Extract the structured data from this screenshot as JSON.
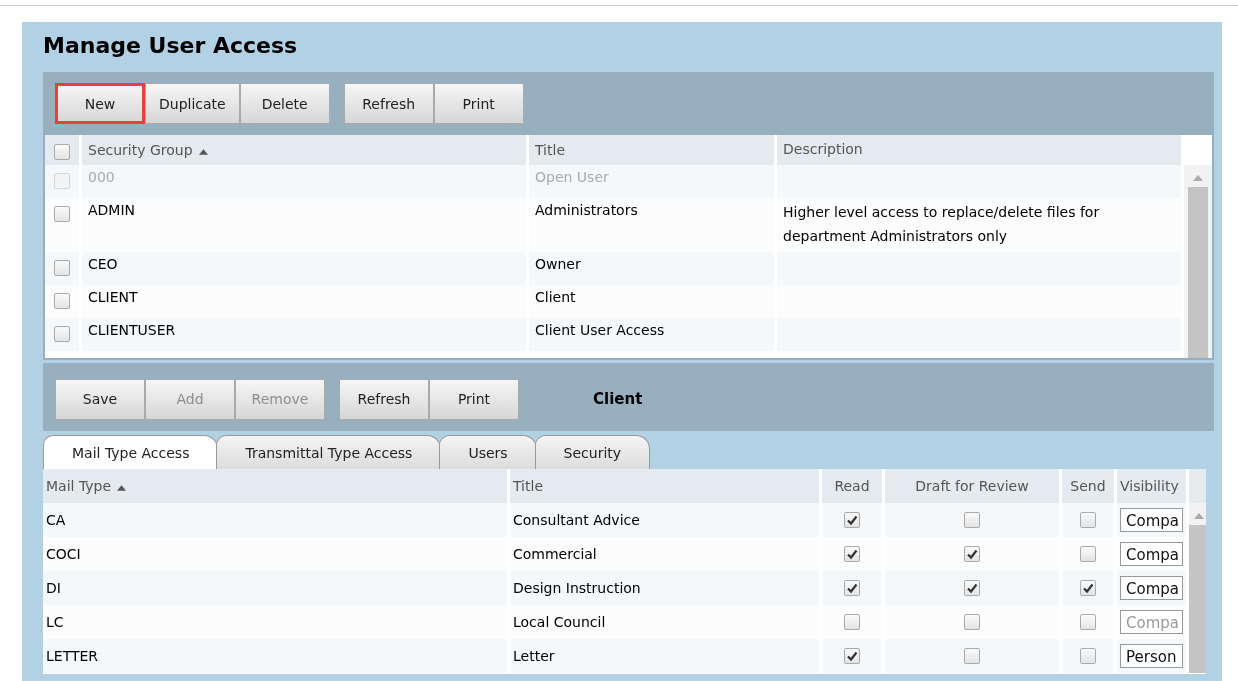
{
  "page_title": "Manage User Access",
  "toolbar": [
    [
      {
        "label": "New",
        "disabled": false,
        "highlighted": true
      },
      {
        "label": "Duplicate",
        "disabled": false,
        "highlighted": false
      },
      {
        "label": "Delete",
        "disabled": false,
        "highlighted": false
      }
    ],
    [
      {
        "label": "Refresh",
        "disabled": false,
        "highlighted": false
      },
      {
        "label": "Print",
        "disabled": false,
        "highlighted": false
      }
    ]
  ],
  "groups_table": {
    "select_all_checked": false,
    "columns": [
      "Security Group",
      "Title",
      "Description"
    ],
    "rows": [
      {
        "group": "000",
        "title": "Open User",
        "description": "",
        "checked": false,
        "disabled": true
      },
      {
        "group": "ADMIN",
        "title": "Administrators",
        "description": "Higher level access to replace/delete files for department Administrators only",
        "checked": false,
        "disabled": false
      },
      {
        "group": "CEO",
        "title": "Owner",
        "description": "",
        "checked": false,
        "disabled": false
      },
      {
        "group": "CLIENT",
        "title": "Client",
        "description": "",
        "checked": false,
        "disabled": false
      },
      {
        "group": "CLIENTUSER",
        "title": "Client User Access",
        "description": "",
        "checked": false,
        "disabled": false
      }
    ]
  },
  "detail_toolbar": {
    "buttons": [
      [
        {
          "label": "Save",
          "disabled": false
        },
        {
          "label": "Add",
          "disabled": true
        },
        {
          "label": "Remove",
          "disabled": true
        }
      ],
      [
        {
          "label": "Refresh",
          "disabled": false
        },
        {
          "label": "Print",
          "disabled": false
        }
      ]
    ],
    "current_group": "Client"
  },
  "tabs": [
    {
      "label": "Mail Type Access",
      "selected": true
    },
    {
      "label": "Transmittal Type Access",
      "selected": false
    },
    {
      "label": "Users",
      "selected": false
    },
    {
      "label": "Security",
      "selected": false
    }
  ],
  "mail_table": {
    "columns": [
      "Mail Type",
      "Title",
      "Read",
      "Draft for Review",
      "Send",
      "Visibility"
    ],
    "rows": [
      {
        "mail_type": "CA",
        "title": "Consultant Advice",
        "read": true,
        "draft": false,
        "send": false,
        "visibility": "Compa",
        "visibility_disabled": false
      },
      {
        "mail_type": "COCI",
        "title": "Commercial",
        "read": true,
        "draft": true,
        "send": false,
        "visibility": "Compa",
        "visibility_disabled": false
      },
      {
        "mail_type": "DI",
        "title": "Design Instruction",
        "read": true,
        "draft": true,
        "send": true,
        "visibility": "Compa",
        "visibility_disabled": false
      },
      {
        "mail_type": "LC",
        "title": "Local Council",
        "read": false,
        "draft": false,
        "send": false,
        "visibility": "Compa",
        "visibility_disabled": true
      },
      {
        "mail_type": "LETTER",
        "title": "Letter",
        "read": true,
        "draft": false,
        "send": false,
        "visibility": "Person",
        "visibility_disabled": false
      }
    ]
  }
}
